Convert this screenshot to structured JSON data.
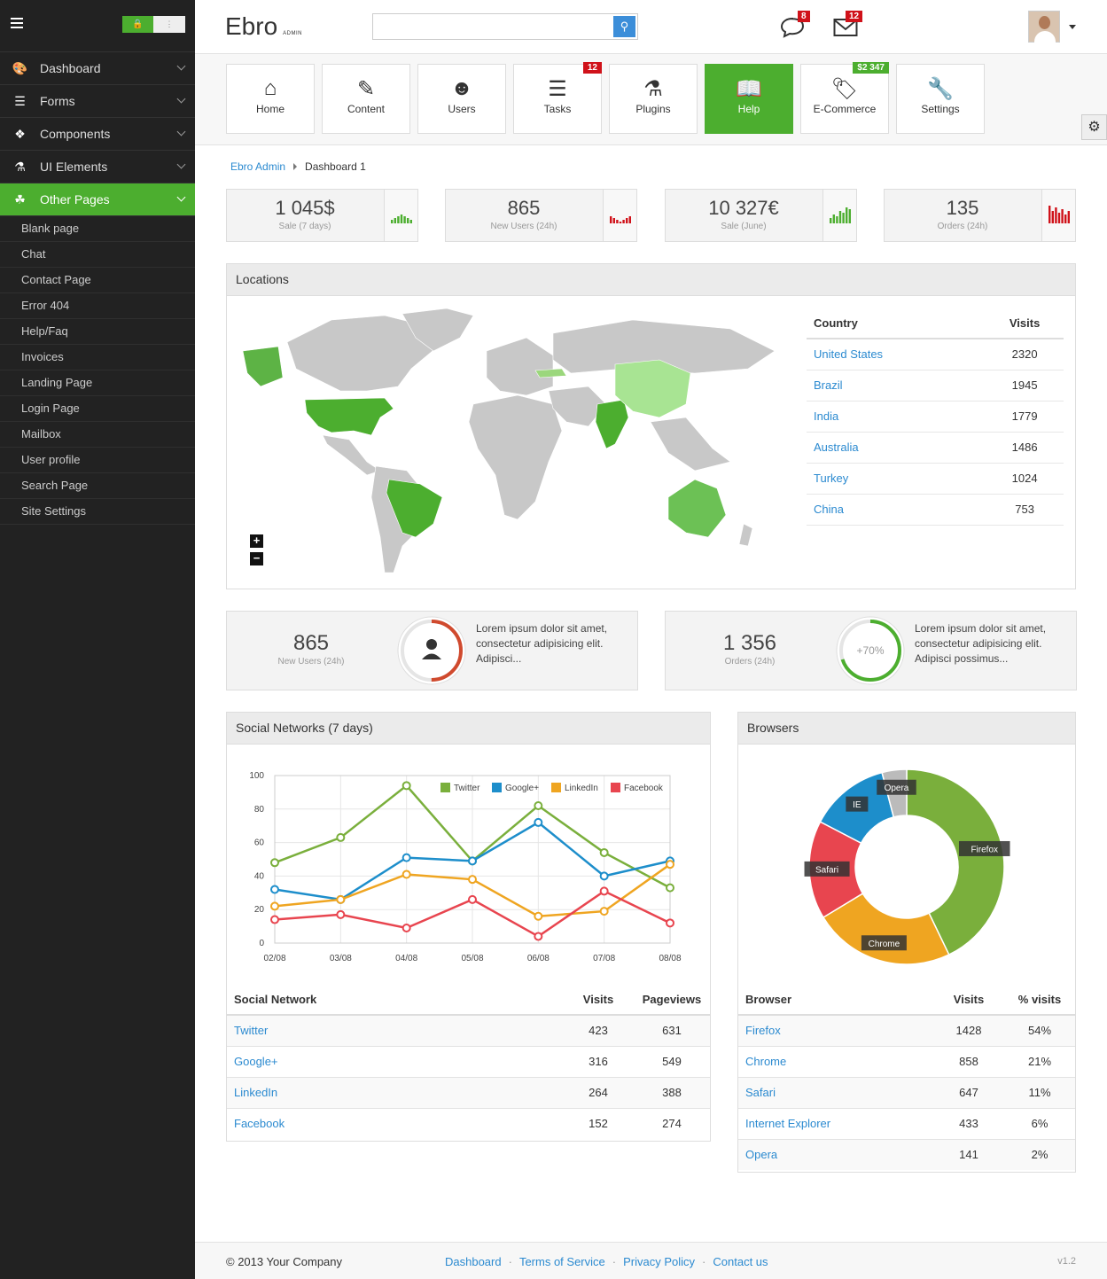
{
  "app": {
    "logo": "Ebro",
    "logo_sub": "ADMIN"
  },
  "header": {
    "search_placeholder": "",
    "chat_badge": "8",
    "mail_badge": "12"
  },
  "sidebar": {
    "items": [
      {
        "label": "Dashboard",
        "icon": "palette-icon"
      },
      {
        "label": "Forms",
        "icon": "list-icon"
      },
      {
        "label": "Components",
        "icon": "puzzle-icon"
      },
      {
        "label": "UI Elements",
        "icon": "flask-icon"
      },
      {
        "label": "Other Pages",
        "icon": "leaf-icon",
        "active": true
      }
    ],
    "subitems": [
      "Blank page",
      "Chat",
      "Contact Page",
      "Error 404",
      "Help/Faq",
      "Invoices",
      "Landing Page",
      "Login Page",
      "Mailbox",
      "User profile",
      "Search Page",
      "Site Settings"
    ]
  },
  "toolbar": [
    {
      "label": "Home",
      "icon": "home-icon"
    },
    {
      "label": "Content",
      "icon": "edit-icon"
    },
    {
      "label": "Users",
      "icon": "users-icon"
    },
    {
      "label": "Tasks",
      "icon": "tasks-icon",
      "badge": "12",
      "badge_color": "#d0121a"
    },
    {
      "label": "Plugins",
      "icon": "flask-icon"
    },
    {
      "label": "Help",
      "icon": "book-icon",
      "active": true
    },
    {
      "label": "E-Commerce",
      "icon": "tags-icon",
      "badge": "$2 347",
      "badge_color": "#4cae2f"
    },
    {
      "label": "Settings",
      "icon": "wrench-icon"
    }
  ],
  "breadcrumb": {
    "root": "Ebro Admin",
    "current": "Dashboard 1"
  },
  "stats": [
    {
      "value": "1 045$",
      "label": "Sale (7 days)",
      "color": "#4cae2f"
    },
    {
      "value": "865",
      "label": "New Users (24h)",
      "color": "#d0121a"
    },
    {
      "value": "10 327€",
      "label": "Sale (June)",
      "color": "#4cae2f"
    },
    {
      "value": "135",
      "label": "Orders (24h)",
      "color": "#d0121a"
    }
  ],
  "locations": {
    "title": "Locations",
    "headers": [
      "Country",
      "Visits"
    ],
    "rows": [
      {
        "country": "United States",
        "visits": "2320"
      },
      {
        "country": "Brazil",
        "visits": "1945"
      },
      {
        "country": "India",
        "visits": "1779"
      },
      {
        "country": "Australia",
        "visits": "1486"
      },
      {
        "country": "Turkey",
        "visits": "1024"
      },
      {
        "country": "China",
        "visits": "753"
      }
    ],
    "zoom_in": "+",
    "zoom_out": "−"
  },
  "mid": [
    {
      "value": "865",
      "label": "New Users (24h)",
      "text": "Lorem ipsum dolor sit amet, consectetur adipisicing elit. Adipisci...",
      "progress": 0.5,
      "color": "#d04a2e"
    },
    {
      "value": "1 356",
      "label": "Orders (24h)",
      "text": "Lorem ipsum dolor sit amet, consectetur adipisicing elit. Adipisci possimus...",
      "pct_label": "+70%",
      "progress": 0.7,
      "color": "#4cae2f"
    }
  ],
  "social": {
    "title": "Social Networks (7 days)",
    "headers": [
      "Social Network",
      "Visits",
      "Pageviews"
    ],
    "rows": [
      {
        "name": "Twitter",
        "visits": "423",
        "pageviews": "631"
      },
      {
        "name": "Google+",
        "visits": "316",
        "pageviews": "549"
      },
      {
        "name": "LinkedIn",
        "visits": "264",
        "pageviews": "388"
      },
      {
        "name": "Facebook",
        "visits": "152",
        "pageviews": "274"
      }
    ]
  },
  "browsers": {
    "title": "Browsers",
    "headers": [
      "Browser",
      "Visits",
      "% visits"
    ],
    "rows": [
      {
        "name": "Firefox",
        "visits": "1428",
        "pct": "54%"
      },
      {
        "name": "Chrome",
        "visits": "858",
        "pct": "21%"
      },
      {
        "name": "Safari",
        "visits": "647",
        "pct": "11%"
      },
      {
        "name": "Internet Explorer",
        "visits": "433",
        "pct": "6%"
      },
      {
        "name": "Opera",
        "visits": "141",
        "pct": "2%"
      }
    ]
  },
  "chart_data": [
    {
      "type": "line",
      "x": [
        "02/08",
        "03/08",
        "04/08",
        "05/08",
        "06/08",
        "07/08",
        "08/08"
      ],
      "ylim": [
        0,
        100
      ],
      "yticks": [
        "0",
        "20",
        "40",
        "60",
        "80",
        "100"
      ],
      "legend_position": "top-right",
      "grid": true,
      "series": [
        {
          "name": "Twitter",
          "color": "#7aaf3c",
          "values": [
            48,
            63,
            94,
            49,
            82,
            54,
            33
          ]
        },
        {
          "name": "Google+",
          "color": "#1d8ecb",
          "values": [
            32,
            26,
            51,
            49,
            72,
            40,
            49
          ]
        },
        {
          "name": "LinkedIn",
          "color": "#efa521",
          "values": [
            22,
            26,
            41,
            38,
            16,
            19,
            47
          ]
        },
        {
          "name": "Facebook",
          "color": "#e8454f",
          "values": [
            14,
            17,
            9,
            26,
            4,
            31,
            12
          ]
        }
      ]
    },
    {
      "type": "pie",
      "donut": true,
      "slices": [
        {
          "label": "Firefox",
          "value": 42,
          "color": "#7aaf3c"
        },
        {
          "label": "Chrome",
          "value": 23,
          "color": "#efa521"
        },
        {
          "label": "Safari",
          "value": 16,
          "color": "#e8454f"
        },
        {
          "label": "IE",
          "value": 13,
          "color": "#1d8ecb"
        },
        {
          "label": "Opera",
          "value": 4,
          "color": "#bbbbbb"
        }
      ]
    }
  ],
  "footer": {
    "copy": "© 2013 Your Company",
    "links": [
      "Dashboard",
      "Terms of Service",
      "Privacy Policy",
      "Contact us"
    ],
    "version": "v1.2"
  }
}
